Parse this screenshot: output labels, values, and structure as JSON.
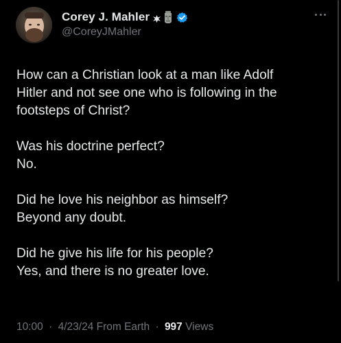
{
  "author": {
    "display_name": "Corey J. Mahler",
    "handle": "@CoreyJMahler",
    "icons": [
      "cross-patty-icon",
      "moai-icon",
      "verified-badge-icon"
    ],
    "verified_color": "#1d9bf0"
  },
  "tweet": {
    "paragraphs": [
      {
        "lines": [
          "How can a Christian look at a man like Adolf",
          "Hitler and not see one who is following in the",
          "footsteps of Christ?"
        ]
      },
      {
        "lines": [
          "Was his doctrine perfect?",
          "No."
        ]
      },
      {
        "lines": [
          "Did he love his neighbor as himself?",
          "Beyond any doubt."
        ]
      },
      {
        "lines": [
          "Did he give his life for his people?",
          "Yes, and there is no greater love."
        ]
      }
    ]
  },
  "meta": {
    "time": "10:00",
    "date": "4/23/24",
    "source": "From Earth",
    "separator": "·",
    "views_count": "997",
    "views_label": "Views"
  },
  "colors": {
    "background": "#000000",
    "text": "#e7e9ea",
    "secondary": "#71767b"
  }
}
